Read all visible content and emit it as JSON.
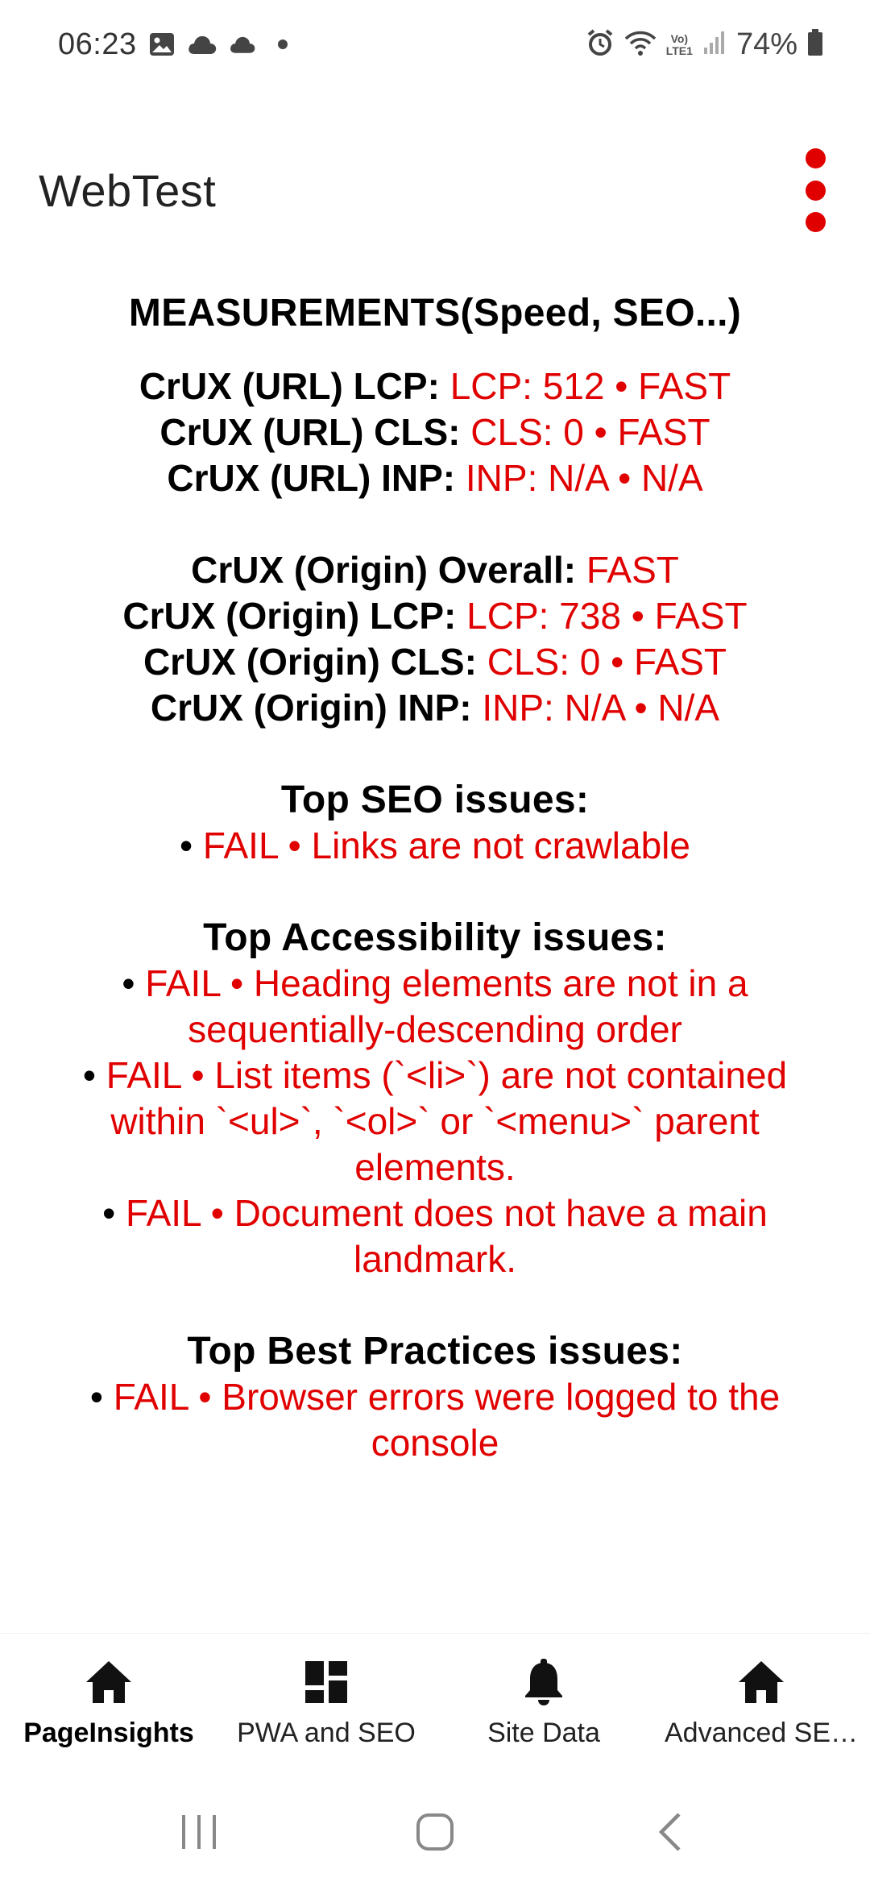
{
  "status_bar": {
    "time": "06:23",
    "battery": "74%",
    "network_label_top": "Vo)",
    "network_label_bottom": "LTE1",
    "icons": [
      "image-icon",
      "cloud-icon",
      "cloud-icon",
      "dot-icon",
      "alarm-icon",
      "wifi-icon",
      "signal-icon",
      "battery-icon"
    ]
  },
  "app_bar": {
    "title": "WebTest",
    "menu_icon": "more-vert-icon",
    "accent_color": "#e00000"
  },
  "content": {
    "main_heading": "MEASUREMENTS(Speed, SEO...)",
    "crux_url": [
      {
        "label": "CrUX (URL) LCP: ",
        "value": "LCP: 512 • FAST"
      },
      {
        "label": "CrUX (URL) CLS: ",
        "value": "CLS: 0 • FAST"
      },
      {
        "label": "CrUX (URL) INP: ",
        "value": "INP: N/A • N/A"
      }
    ],
    "crux_origin": [
      {
        "label": "CrUX (Origin) Overall: ",
        "value": "FAST"
      },
      {
        "label": "CrUX (Origin) LCP: ",
        "value": "LCP: 738 • FAST"
      },
      {
        "label": "CrUX (Origin) CLS: ",
        "value": "CLS: 0 • FAST"
      },
      {
        "label": "CrUX (Origin) INP: ",
        "value": "INP: N/A • N/A"
      }
    ],
    "seo": {
      "heading": "Top SEO issues:",
      "items": [
        {
          "bullet": "• ",
          "text": "FAIL • Links are not crawlable"
        }
      ]
    },
    "accessibility": {
      "heading": "Top Accessibility issues:",
      "items": [
        {
          "bullet": "• ",
          "text": "FAIL • Heading elements are not in a sequentially-descending order"
        },
        {
          "bullet": "• ",
          "text": "FAIL • List items (`<li>`) are not contained within `<ul>`, `<ol>` or `<menu>` parent elements."
        },
        {
          "bullet": "• ",
          "text": "FAIL • Document does not have a main landmark."
        }
      ]
    },
    "best_practices": {
      "heading": "Top Best Practices issues:",
      "items": [
        {
          "bullet": "• ",
          "text": "FAIL • Browser errors were logged to the console"
        }
      ]
    }
  },
  "bottom_nav": {
    "items": [
      {
        "label": "PageInsights",
        "icon": "home-icon",
        "active": true
      },
      {
        "label": "PWA and SEO",
        "icon": "dashboard-icon",
        "active": false
      },
      {
        "label": "Site Data",
        "icon": "bell-icon",
        "active": false
      },
      {
        "label": "Advanced SE…",
        "icon": "home-icon",
        "active": false
      }
    ]
  },
  "system_nav": {
    "icons": [
      "recent-apps-icon",
      "home-circle-icon",
      "back-icon"
    ]
  }
}
